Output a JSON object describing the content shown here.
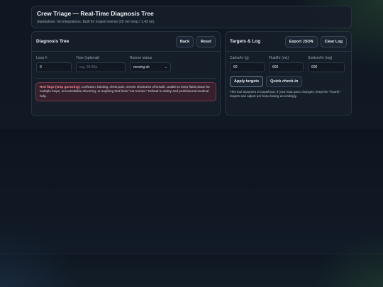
{
  "header": {
    "title": "Crew Triage — Real-Time Diagnosis Tree",
    "subtitle": "Standalone. No integrations. Built for looped events (20 min loop / 1.42 mi)."
  },
  "diagnosis": {
    "title": "Diagnosis Tree",
    "back_label": "Back",
    "reset_label": "Reset",
    "loop_label": "Loop #",
    "loop_value": "0",
    "time_label": "Time (optional)",
    "time_placeholder": "e.g. 03:40a",
    "status_label": "Runner status",
    "status_value": "moving ok",
    "red_flags_lead": "Red flags (stop guessing):",
    "red_flags_text": " confusion, fainting, chest pain, severe shortness of breath, unable to keep fluids down for multiple loops, uncontrollable shivering, or anything that feels \"not normal.\" Default to safety and professional medical help."
  },
  "targets": {
    "title": "Targets & Log",
    "export_label": "Export JSON",
    "clear_label": "Clear Log",
    "carbs_label": "Carbs/hr (g)",
    "carbs_value": "60",
    "fluid_label": "Fluid/hr (mL)",
    "fluid_value": "600",
    "sodium_label": "Sodium/hr (mg)",
    "sodium_value": "600",
    "apply_label": "Apply targets",
    "checkin_label": "Quick check-in",
    "note": "This tool assumes 3 loops/hour. If your loop pace changes, keep the *hourly* targets and adjust per-loop dosing accordingly."
  }
}
